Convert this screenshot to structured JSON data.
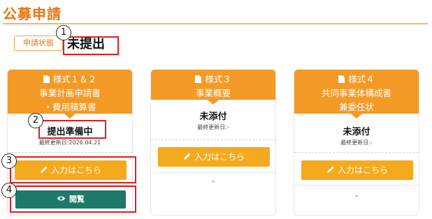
{
  "page": {
    "title": "公募申請"
  },
  "application_status": {
    "label": "申請状態",
    "value": "未提出"
  },
  "markers": [
    "1",
    "2",
    "3",
    "4"
  ],
  "cards": [
    {
      "header_lines": [
        "様式１＆２",
        "事業計画申請書",
        "・費用積算書"
      ],
      "status": "提出準備中",
      "updated": "最終更新日:2026.04.21",
      "input_button": "入力はこちら",
      "view_button": "閲覧"
    },
    {
      "header_lines": [
        "様式３",
        "事業概要"
      ],
      "status": "未添付",
      "updated": "最終更新日:-",
      "input_button": "入力はこちら",
      "footer": "-"
    },
    {
      "header_lines": [
        "様式４",
        "共同事業体構成書",
        "兼委任状"
      ],
      "status": "未添付",
      "updated": "最終更新日:-",
      "input_button": "入力はこちら",
      "footer": "-"
    }
  ],
  "colors": {
    "accent": "#f39a26",
    "title": "#e8740f",
    "button": "#f5aa1d",
    "view_button": "#1d7a6b",
    "highlight": "#e01d1d"
  },
  "icons": {
    "header": "document-icon",
    "input": "pencil-icon",
    "view": "eye-icon"
  }
}
